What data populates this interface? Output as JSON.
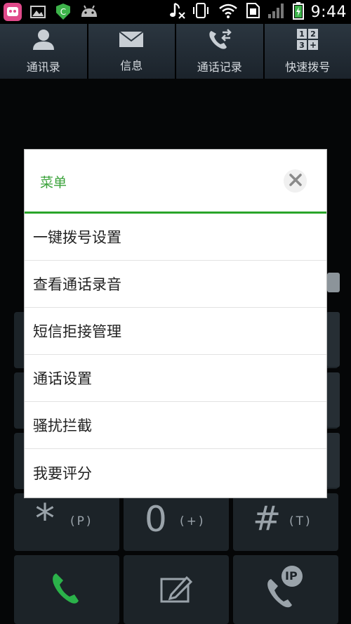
{
  "status_bar": {
    "time": "9:44",
    "icons": [
      "app-badge-icon",
      "gallery-icon",
      "security-icon",
      "android-icon",
      "music-off-icon",
      "vibrate-icon",
      "wifi-icon",
      "sim-icon",
      "signal-icon",
      "battery-charging-icon"
    ]
  },
  "tabs": [
    {
      "label": "通讯录",
      "icon": "contacts-icon"
    },
    {
      "label": "信息",
      "icon": "message-icon"
    },
    {
      "label": "通话记录",
      "icon": "call-log-icon"
    },
    {
      "label": "快速拨号",
      "icon": "speed-dial-icon"
    }
  ],
  "dialog": {
    "title": "菜单",
    "items": [
      "一键拨号设置",
      "查看通话录音",
      "短信拒接管理",
      "通话设置",
      "骚扰拦截",
      "我要评分"
    ]
  },
  "keypad": {
    "star": {
      "main": "*",
      "sub": "(P)"
    },
    "zero": {
      "main": "0",
      "sub": "(+)"
    },
    "hash": {
      "main": "#",
      "sub": "(T)"
    },
    "ip_label": "IP"
  },
  "colors": {
    "accent": "#2aa52a",
    "title": "#3aa23a"
  }
}
